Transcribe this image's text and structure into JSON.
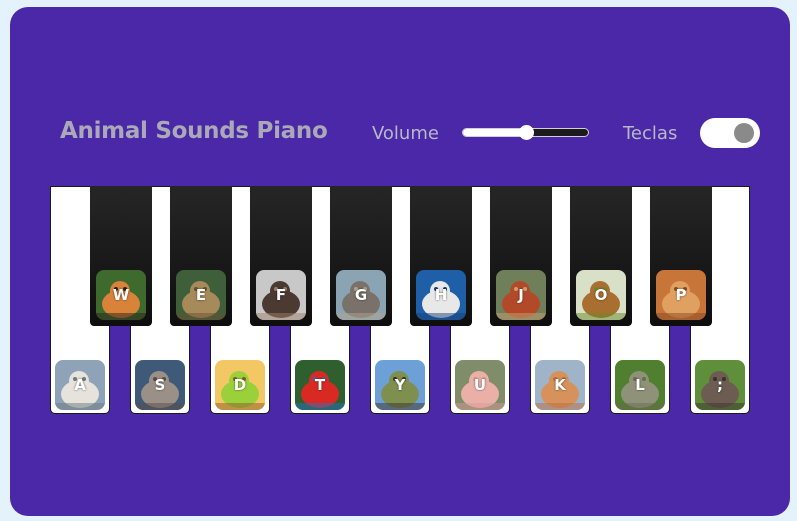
{
  "header": {
    "title": "Animal Sounds Piano",
    "volume_label": "Volume",
    "volume_level": 0.5,
    "keys_label": "Teclas",
    "keys_toggle_on": true
  },
  "white_keys": [
    {
      "key": "A",
      "animal_icon": "dog-icon",
      "colors": [
        "#8ea3b8",
        "#e6e2dc",
        "#6c7a7c"
      ]
    },
    {
      "key": "S",
      "animal_icon": "wolf-icon",
      "colors": [
        "#3f5a78",
        "#9a9088",
        "#5b4d41"
      ]
    },
    {
      "key": "D",
      "animal_icon": "parakeet-icon",
      "colors": [
        "#f3c764",
        "#9ad13a",
        "#8a5a2b"
      ]
    },
    {
      "key": "T",
      "animal_icon": "macaw-icon",
      "colors": [
        "#2f5f2e",
        "#d82a22",
        "#2a6fc0"
      ]
    },
    {
      "key": "Y",
      "animal_icon": "cow-icon",
      "colors": [
        "#6ea0d8",
        "#7f8f4f",
        "#3b3226"
      ]
    },
    {
      "key": "U",
      "animal_icon": "pig-icon",
      "colors": [
        "#7f8d6a",
        "#eab0a8",
        "#d69a92"
      ]
    },
    {
      "key": "K",
      "animal_icon": "cat-icon",
      "colors": [
        "#9fb4c8",
        "#d7915a",
        "#b8703f"
      ]
    },
    {
      "key": "L",
      "animal_icon": "monkey-icon",
      "colors": [
        "#4f7f2f",
        "#8f9278",
        "#6a6b52"
      ]
    },
    {
      "key": ";",
      "animal_icon": "donkey-icon",
      "colors": [
        "#5f8f3a",
        "#6c5c52",
        "#3b312b"
      ]
    }
  ],
  "black_keys": [
    {
      "key": "W",
      "animal_icon": "tiger-icon",
      "colors": [
        "#3e6a2e",
        "#d8823a",
        "#2a2218"
      ]
    },
    {
      "key": "E",
      "animal_icon": "snake-icon",
      "colors": [
        "#3f5f3a",
        "#a78a5a",
        "#6a4f32"
      ]
    },
    {
      "key": "F",
      "animal_icon": "chimpanzee-icon",
      "colors": [
        "#c8c8c8",
        "#4a3a32",
        "#a0806a"
      ]
    },
    {
      "key": "G",
      "animal_icon": "elephant-icon",
      "colors": [
        "#8aa4b4",
        "#7a726a",
        "#b0a38e"
      ]
    },
    {
      "key": "H",
      "animal_icon": "seagull-icon",
      "colors": [
        "#1f5fa8",
        "#e8e8e8",
        "#1a3f78"
      ]
    },
    {
      "key": "J",
      "animal_icon": "hen-icon",
      "colors": [
        "#6f7f5a",
        "#b24a2a",
        "#c8a070"
      ]
    },
    {
      "key": "O",
      "animal_icon": "lion-icon",
      "colors": [
        "#d8e0c8",
        "#a86f30",
        "#6a8a2a"
      ]
    },
    {
      "key": "P",
      "animal_icon": "jaguar-icon",
      "colors": [
        "#c8753a",
        "#e0a060",
        "#8a4a20"
      ]
    }
  ]
}
